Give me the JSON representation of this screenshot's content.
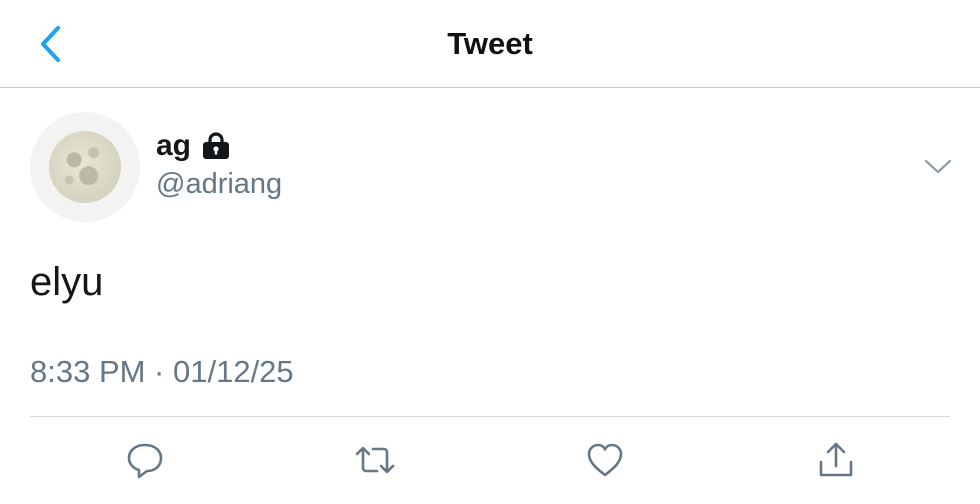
{
  "header": {
    "title": "Tweet",
    "back_icon": "chevron-left-icon",
    "accent_color": "#1da1f2"
  },
  "author": {
    "display_name": "ag",
    "handle": "@adriang",
    "avatar_icon": "full-moon-avatar",
    "protected_icon": "lock-icon"
  },
  "tweet": {
    "text": "elyu",
    "timestamp": "8:33 PM · 01/12/25",
    "more_icon": "chevron-down-icon"
  },
  "actions": [
    {
      "name": "reply",
      "icon": "comment-bubble-icon"
    },
    {
      "name": "retweet",
      "icon": "retweet-icon"
    },
    {
      "name": "like",
      "icon": "heart-icon"
    },
    {
      "name": "share",
      "icon": "share-icon"
    }
  ],
  "colors": {
    "text_primary": "#14171a",
    "text_secondary": "#657786",
    "icon_gray": "#657786"
  }
}
